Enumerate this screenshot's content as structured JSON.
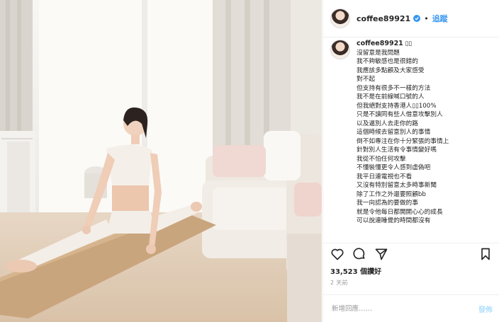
{
  "header": {
    "username": "coffee89921",
    "separator": "•",
    "follow_label": "追蹤"
  },
  "caption": {
    "username": "coffee89921",
    "emoji": "▯▯",
    "lines": [
      "沒留意是我問題",
      "我不夠敏感也是很錯的",
      "我應該多點顧及大家感受",
      "對不起",
      "但支持有很多不一樣的方法",
      "我不是在前線喊口號的人",
      "但我絕對支持香港人▯▯100%",
      "只是不讀同有些人借意攻擊別人",
      "以及逼別人去走你的路",
      "這個時候去留意別人的事情",
      "倒不如專注在你十分緊張的事情上",
      "針對別人生活有令事情變好嗎",
      "我從不怕任何攻擊",
      "不懂裝懂更令人感到虛偽吧",
      "我平日連電視也不看",
      "又沒有特別留意太多時事新聞",
      "除了工作之外還要照顧bb",
      "我一向認為的要做的事",
      "就是令他每日都開開心心的成長",
      "可以說連睡覺的時間都沒有"
    ]
  },
  "actions": {
    "like_icon": "heart-icon",
    "comment_icon": "comment-icon",
    "bookmark_icon": "bookmark-icon"
  },
  "likes_text": "33,523 個讚好",
  "time_text": "2 天前",
  "comment_box": {
    "placeholder": "新增回應……",
    "post_label": "發佈"
  },
  "colors": {
    "link_blue": "#3897f0",
    "post_disabled": "#b2dffc",
    "border": "#efefef"
  }
}
